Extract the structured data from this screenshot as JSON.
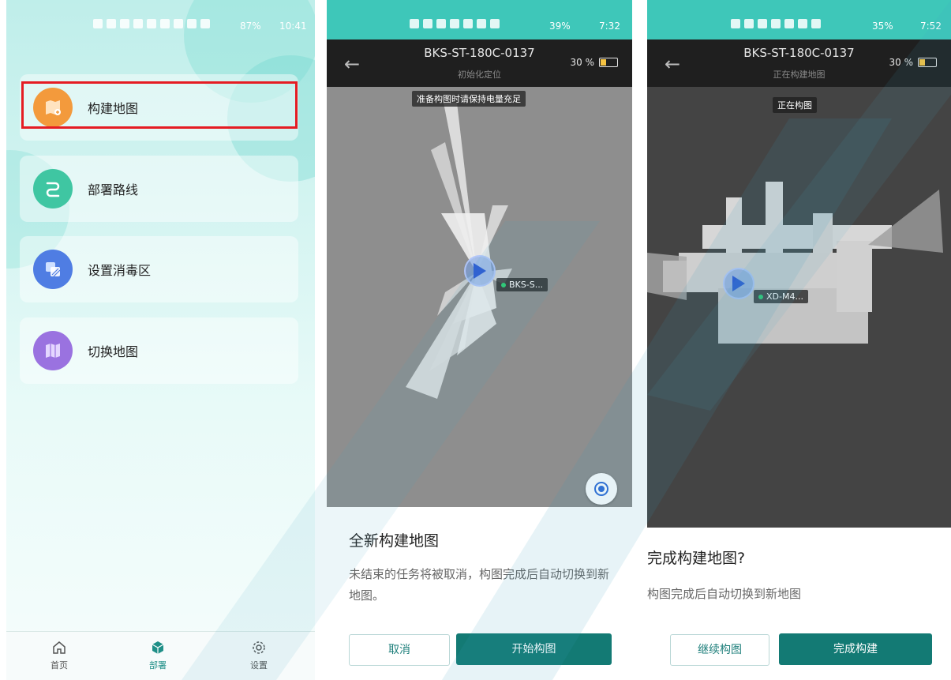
{
  "panel1": {
    "status_time": "10:41",
    "status_battery": "87%",
    "menu": [
      {
        "label": "构建地图",
        "color": "#f39a3c"
      },
      {
        "label": "部署路线",
        "color": "#3fc6a2"
      },
      {
        "label": "设置消毒区",
        "color": "#4f7de3"
      },
      {
        "label": "切换地图",
        "color": "#9a72e0"
      }
    ],
    "tabs": [
      {
        "label": "首页",
        "icon": "home-icon"
      },
      {
        "label": "部署",
        "icon": "cube-icon",
        "active": true
      },
      {
        "label": "设置",
        "icon": "gear-icon"
      }
    ]
  },
  "panel2": {
    "status_time": "7:32",
    "status_battery": "39%",
    "title": "BKS-ST-180C-0137",
    "subtitle": "初始化定位",
    "battery_text": "30 %",
    "battery_level": 0.3,
    "hint_chip": "准备构图时请保持电量充足",
    "robot_label": "BKS-S...",
    "sheet_title": "全新构建地图",
    "sheet_body": "未结束的任务将被取消，构图完成后自动切换到新地图。",
    "cancel_label": "取消",
    "confirm_label": "开始构图"
  },
  "panel3": {
    "status_time": "7:52",
    "status_battery": "35%",
    "title": "BKS-ST-180C-0137",
    "subtitle": "正在构建地图",
    "battery_text": "30 %",
    "battery_level": 0.3,
    "status_chip": "正在构图",
    "robot_label": "XD-M4...",
    "sheet_title": "完成构建地图?",
    "sheet_body": "构图完成后自动切换到新地图",
    "continue_label": "继续构图",
    "finish_label": "完成构建"
  },
  "colors": {
    "accent": "#137a74",
    "status_bar": "#3ec7b9",
    "highlight": "#e51c23"
  }
}
